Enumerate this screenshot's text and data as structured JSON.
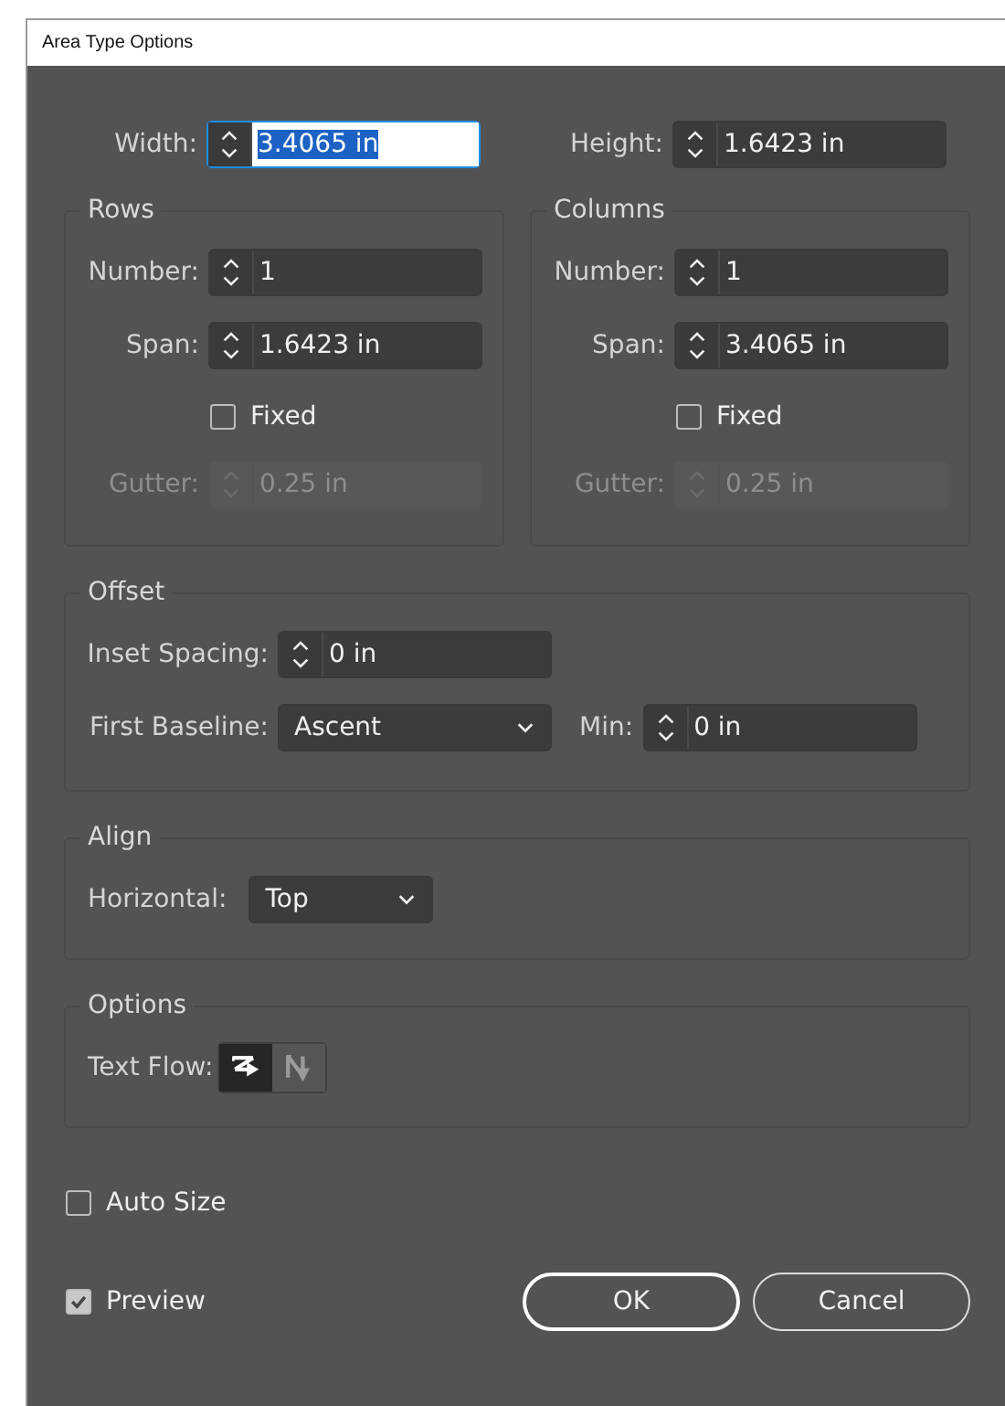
{
  "window": {
    "title": "Area Type Options"
  },
  "size": [
    {
      "label": "Width:",
      "value": "3.4065 in",
      "focused": true
    },
    {
      "label": "Height:",
      "value": "1.6423 in",
      "focused": false
    }
  ],
  "groups": [
    {
      "title": "Rows",
      "number": {
        "label": "Number:",
        "value": "1"
      },
      "span": {
        "label": "Span:",
        "value": "1.6423 in"
      },
      "fixed": {
        "label": "Fixed",
        "checked": false
      },
      "gutter": {
        "label": "Gutter:",
        "value": "0.25 in",
        "disabled": true
      }
    },
    {
      "title": "Columns",
      "number": {
        "label": "Number:",
        "value": "1"
      },
      "span": {
        "label": "Span:",
        "value": "3.4065 in"
      },
      "fixed": {
        "label": "Fixed",
        "checked": false
      },
      "gutter": {
        "label": "Gutter:",
        "value": "0.25 in",
        "disabled": true
      }
    }
  ],
  "offset": {
    "title": "Offset",
    "inset_spacing": {
      "label": "Inset Spacing:",
      "value": "0 in"
    },
    "first_baseline": {
      "label": "First Baseline:",
      "value": "Ascent"
    },
    "min": {
      "label": "Min:",
      "value": "0 in"
    }
  },
  "align": {
    "title": "Align",
    "horizontal": {
      "label": "Horizontal:",
      "value": "Top"
    }
  },
  "options": {
    "title": "Options",
    "text_flow": {
      "label": "Text Flow:",
      "buttons": [
        {
          "kind": "rows",
          "selected": true
        },
        {
          "kind": "columns",
          "selected": false
        }
      ]
    }
  },
  "auto_size": {
    "label": "Auto Size",
    "checked": false
  },
  "preview": {
    "label": "Preview",
    "checked": true
  },
  "buttons": [
    {
      "label": "OK",
      "default": true
    },
    {
      "label": "Cancel",
      "default": false
    }
  ]
}
